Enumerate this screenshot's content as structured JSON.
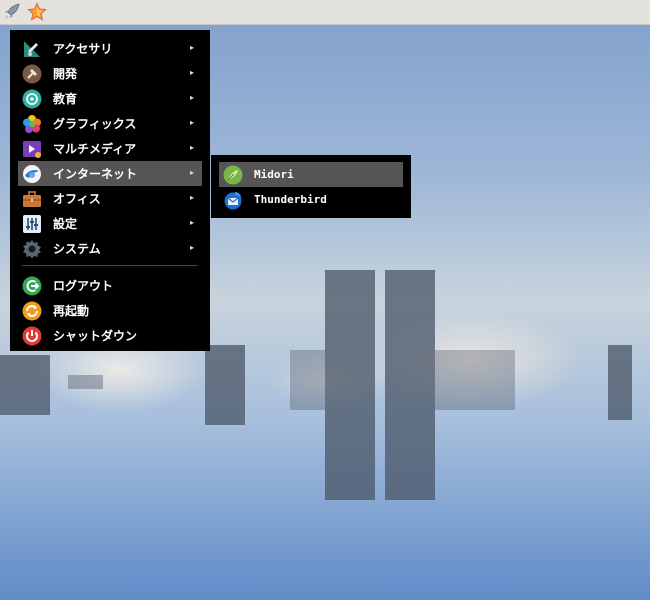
{
  "panel": {
    "launcher_icon": "rocket-icon",
    "menu_icon": "star-icon"
  },
  "menu": {
    "items": [
      {
        "label": "アクセサリ",
        "icon": "accessories-icon",
        "has_submenu": true
      },
      {
        "label": "開発",
        "icon": "development-icon",
        "has_submenu": true
      },
      {
        "label": "教育",
        "icon": "education-icon",
        "has_submenu": true
      },
      {
        "label": "グラフィックス",
        "icon": "graphics-icon",
        "has_submenu": true
      },
      {
        "label": "マルチメディア",
        "icon": "multimedia-icon",
        "has_submenu": true
      },
      {
        "label": "インターネット",
        "icon": "internet-icon",
        "has_submenu": true,
        "active": true
      },
      {
        "label": "オフィス",
        "icon": "office-icon",
        "has_submenu": true
      },
      {
        "label": "設定",
        "icon": "settings-icon",
        "has_submenu": true
      },
      {
        "label": "システム",
        "icon": "system-icon",
        "has_submenu": true
      }
    ],
    "actions": [
      {
        "label": "ログアウト",
        "icon": "logout-icon"
      },
      {
        "label": "再起動",
        "icon": "reboot-icon"
      },
      {
        "label": "シャットダウン",
        "icon": "shutdown-icon"
      }
    ],
    "submenu_arrow": "▸"
  },
  "submenu": {
    "items": [
      {
        "label": "Midori",
        "icon": "midori-icon",
        "active": true
      },
      {
        "label": "Thunderbird",
        "icon": "thunderbird-icon"
      }
    ]
  },
  "colors": {
    "menu_bg": "#000000",
    "highlight": "#555555",
    "panel_bg": "#e3e2de"
  }
}
